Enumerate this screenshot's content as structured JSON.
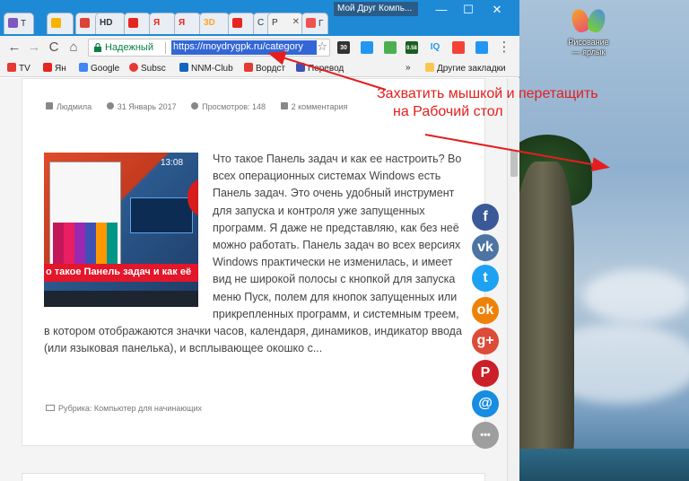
{
  "desktop": {
    "icon_label_1": "Рисование",
    "icon_label_2": "— ярлык"
  },
  "window": {
    "title": "Мой Друг Компь...",
    "minimize": "—",
    "maximize": "☐",
    "close": "✕"
  },
  "tabs": [
    {
      "label": "Т",
      "color": "#7e57c2"
    },
    {
      "label": "",
      "color": "#f4b400"
    },
    {
      "label": "",
      "color": "#db4437"
    },
    {
      "label": "HD",
      "color": "#333333"
    },
    {
      "label": "Я",
      "color": "#e52620"
    },
    {
      "label": "Я",
      "color": "#e52620"
    },
    {
      "label": "3D",
      "color": "#f9a825"
    },
    {
      "label": "",
      "color": "#e52620"
    },
    {
      "label": "С",
      "color": "#e53935"
    },
    {
      "label": "Р",
      "color": "#ffffff"
    },
    {
      "label": "Г",
      "color": "#ef5350"
    }
  ],
  "toolbar": {
    "back": "←",
    "forward": "→",
    "reload": "C",
    "home": "⌂",
    "secure_label": "Надежный",
    "url": "https://moydrygpk.ru/category",
    "star": "☆",
    "ext_badge_1": "30",
    "ext_badge_2": "0.58",
    "ext_iq": "IQ"
  },
  "bookmarks": {
    "items": [
      "TV",
      "Ян",
      "Google",
      "Subsc",
      "NNM-Club",
      "Вордст",
      "Перевод"
    ],
    "overflow": "»",
    "other": "Другие закладки"
  },
  "post": {
    "author": "Людмила",
    "date": "31 Январь 2017",
    "views_label": "Просмотров:",
    "views": "148",
    "comments": "2 комментария",
    "thumb_banner": "о такое Панель задач и как её",
    "thumb_clock": "13:08",
    "body": "Что такое Панель задач и как ее настроить? Во всех операционных системах Windows есть Панель задач. Это очень удобный инструмент для запуска и контроля уже запущенных программ. Я даже не представляю, как без неё можно работать. Панель задач во всех версиях Windows практически не изменилась, и имеет вид не широкой полосы с кнопкой для запуска меню Пуск, полем для кнопок запущенных или прикрепленных программ, и системным треем, в котором отображаются значки часов, календаря, динамиков, индикатор ввода (или языковая панелька), и всплывающее окошко с...",
    "rubric": "Рубрика: Компьютер для начинающих"
  },
  "social": [
    {
      "name": "facebook",
      "glyph": "f",
      "color": "#3b5998"
    },
    {
      "name": "vk",
      "glyph": "vk",
      "color": "#4c75a3"
    },
    {
      "name": "twitter",
      "glyph": "t",
      "color": "#1da1f2"
    },
    {
      "name": "odnoklassniki",
      "glyph": "ok",
      "color": "#ee8208"
    },
    {
      "name": "googleplus",
      "glyph": "g+",
      "color": "#dd4b39"
    },
    {
      "name": "pinterest",
      "glyph": "P",
      "color": "#cb2027"
    },
    {
      "name": "mail",
      "glyph": "@",
      "color": "#168de2"
    },
    {
      "name": "more",
      "glyph": "•••",
      "color": "#9e9e9e"
    }
  ],
  "annotation": {
    "line1": "Захватить мышкой и перетащить",
    "line2": "на Рабочий стол",
    "color": "#e41e1e"
  }
}
